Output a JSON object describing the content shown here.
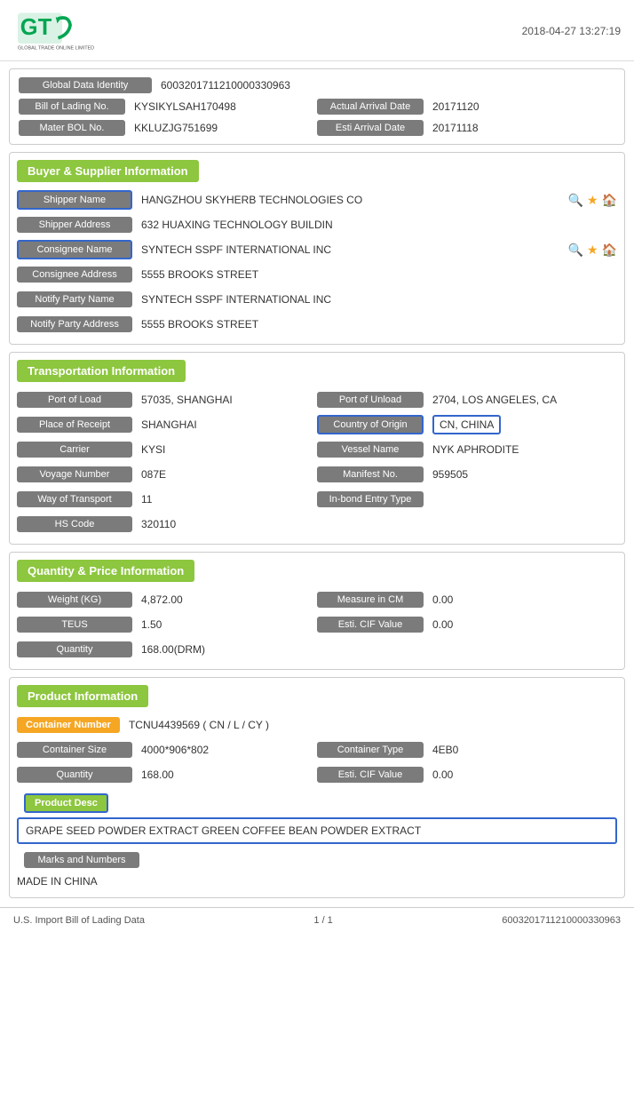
{
  "header": {
    "timestamp": "2018-04-27 13:27:19"
  },
  "identity": {
    "global_data_label": "Global Data Identity",
    "global_data_value": "60032017112100003309​63",
    "bol_label": "Bill of Lading No.",
    "bol_value": "KYSIKYLSAH170498",
    "actual_arrival_label": "Actual Arrival Date",
    "actual_arrival_value": "20171120",
    "mater_bol_label": "Mater BOL No.",
    "mater_bol_value": "KKLUZJG751699",
    "esti_arrival_label": "Esti Arrival Date",
    "esti_arrival_value": "20171118"
  },
  "buyer_supplier": {
    "section_title": "Buyer & Supplier Information",
    "shipper_name_label": "Shipper Name",
    "shipper_name_value": "HANGZHOU SKYHERB TECHNOLOGIES CO",
    "shipper_address_label": "Shipper Address",
    "shipper_address_value": "632 HUAXING TECHNOLOGY BUILDIN",
    "consignee_name_label": "Consignee Name",
    "consignee_name_value": "SYNTECH SSPF INTERNATIONAL INC",
    "consignee_address_label": "Consignee Address",
    "consignee_address_value": "5555 BROOKS STREET",
    "notify_party_name_label": "Notify Party Name",
    "notify_party_name_value": "SYNTECH SSPF INTERNATIONAL INC",
    "notify_party_address_label": "Notify Party Address",
    "notify_party_address_value": "5555 BROOKS STREET"
  },
  "transportation": {
    "section_title": "Transportation Information",
    "port_of_load_label": "Port of Load",
    "port_of_load_value": "57035, SHANGHAI",
    "port_of_unload_label": "Port of Unload",
    "port_of_unload_value": "2704, LOS ANGELES, CA",
    "place_of_receipt_label": "Place of Receipt",
    "place_of_receipt_value": "SHANGHAI",
    "country_of_origin_label": "Country of Origin",
    "country_of_origin_value": "CN, CHINA",
    "carrier_label": "Carrier",
    "carrier_value": "KYSI",
    "vessel_name_label": "Vessel Name",
    "vessel_name_value": "NYK APHRODITE",
    "voyage_number_label": "Voyage Number",
    "voyage_number_value": "087E",
    "manifest_no_label": "Manifest No.",
    "manifest_no_value": "959505",
    "way_of_transport_label": "Way of Transport",
    "way_of_transport_value": "11",
    "inbond_entry_label": "In-bond Entry Type",
    "inbond_entry_value": "",
    "hs_code_label": "HS Code",
    "hs_code_value": "320110"
  },
  "quantity_price": {
    "section_title": "Quantity & Price Information",
    "weight_label": "Weight (KG)",
    "weight_value": "4,872.00",
    "measure_label": "Measure in CM",
    "measure_value": "0.00",
    "teus_label": "TEUS",
    "teus_value": "1.50",
    "esti_cif_label": "Esti. CIF Value",
    "esti_cif_value": "0.00",
    "quantity_label": "Quantity",
    "quantity_value": "168.00(DRM)"
  },
  "product_info": {
    "section_title": "Product Information",
    "container_number_label": "Container Number",
    "container_number_value": "TCNU4439569 ( CN / L / CY )",
    "container_size_label": "Container Size",
    "container_size_value": "4000*906*802",
    "container_type_label": "Container Type",
    "container_type_value": "4EB0",
    "quantity_label": "Quantity",
    "quantity_value": "168.00",
    "esti_cif_label": "Esti. CIF Value",
    "esti_cif_value": "0.00",
    "product_desc_label": "Product Desc",
    "product_desc_value": "GRAPE SEED POWDER EXTRACT GREEN COFFEE BEAN POWDER EXTRACT",
    "marks_label": "Marks and Numbers",
    "marks_value": "MADE IN CHINA"
  },
  "footer": {
    "left_text": "U.S. Import Bill of Lading Data",
    "center_text": "1 / 1",
    "right_text": "60032017112100003309​63"
  }
}
